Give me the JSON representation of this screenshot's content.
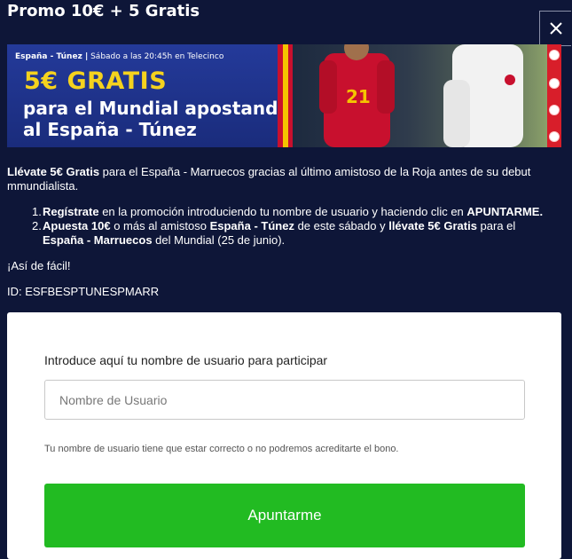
{
  "header": {
    "title": "Promo 10€ + 5 Gratis"
  },
  "banner": {
    "subtitle_bold": "España - Túnez |",
    "subtitle_rest": " Sábado a las 20:45h en Telecinco",
    "headline": "5€ GRATIS",
    "line1": "para el Mundial apostando",
    "line2": "al España - Túnez",
    "player_number": "21"
  },
  "body": {
    "intro_bold": "Llévate 5€ Gratis",
    "intro_rest": " para el España - Marruecos gracias al último amistoso de la Roja antes de su debut mmundialista.",
    "steps": [
      {
        "num": "1.",
        "a_bold": "Regístrate",
        "b": " en la promoción introduciendo tu nombre de usuario y haciendo clic en ",
        "c_bold": "APUNTARME.",
        "d": "",
        "e_bold": "",
        "f": "",
        "g_bold": "",
        "h": ""
      },
      {
        "num": "2.",
        "a_bold": "Apuesta 10€",
        "b": " o más al amistoso ",
        "c_bold": "España - Túnez",
        "d": " de este sábado y ",
        "e_bold": "llévate 5€ Gratis",
        "f": " para el  ",
        "g_bold": "España - Marruecos",
        "h": " del Mundial (25 de junio)."
      }
    ],
    "easy": "¡Así de fácil!",
    "promo_id": "ID: ESFBESPTUNESPMARR"
  },
  "form": {
    "label": "Introduce aquí tu nombre de usuario para participar",
    "username_placeholder": "Nombre de Usuario",
    "username_value": "",
    "hint": "Tu nombre de usuario tiene que estar correcto o no podremos acreditarte el bono.",
    "submit_label": "Apuntarme"
  },
  "colors": {
    "background": "#0e1638",
    "headline_yellow": "#f5d21e",
    "button_green": "#22bb22",
    "accent_red": "#d81e2a"
  },
  "icons": {
    "close": "close-icon"
  }
}
